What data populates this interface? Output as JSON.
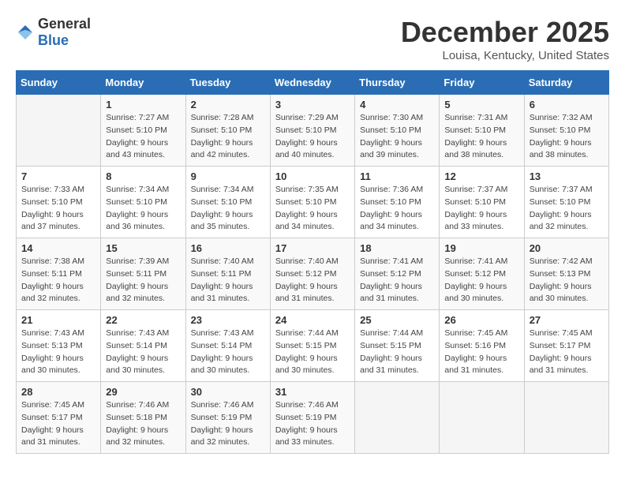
{
  "header": {
    "logo": {
      "general": "General",
      "blue": "Blue"
    },
    "title": "December 2025",
    "location": "Louisa, Kentucky, United States"
  },
  "days_of_week": [
    "Sunday",
    "Monday",
    "Tuesday",
    "Wednesday",
    "Thursday",
    "Friday",
    "Saturday"
  ],
  "weeks": [
    [
      {
        "day": "",
        "sunrise": "",
        "sunset": "",
        "daylight": ""
      },
      {
        "day": "1",
        "sunrise": "Sunrise: 7:27 AM",
        "sunset": "Sunset: 5:10 PM",
        "daylight": "Daylight: 9 hours and 43 minutes."
      },
      {
        "day": "2",
        "sunrise": "Sunrise: 7:28 AM",
        "sunset": "Sunset: 5:10 PM",
        "daylight": "Daylight: 9 hours and 42 minutes."
      },
      {
        "day": "3",
        "sunrise": "Sunrise: 7:29 AM",
        "sunset": "Sunset: 5:10 PM",
        "daylight": "Daylight: 9 hours and 40 minutes."
      },
      {
        "day": "4",
        "sunrise": "Sunrise: 7:30 AM",
        "sunset": "Sunset: 5:10 PM",
        "daylight": "Daylight: 9 hours and 39 minutes."
      },
      {
        "day": "5",
        "sunrise": "Sunrise: 7:31 AM",
        "sunset": "Sunset: 5:10 PM",
        "daylight": "Daylight: 9 hours and 38 minutes."
      },
      {
        "day": "6",
        "sunrise": "Sunrise: 7:32 AM",
        "sunset": "Sunset: 5:10 PM",
        "daylight": "Daylight: 9 hours and 38 minutes."
      }
    ],
    [
      {
        "day": "7",
        "sunrise": "Sunrise: 7:33 AM",
        "sunset": "Sunset: 5:10 PM",
        "daylight": "Daylight: 9 hours and 37 minutes."
      },
      {
        "day": "8",
        "sunrise": "Sunrise: 7:34 AM",
        "sunset": "Sunset: 5:10 PM",
        "daylight": "Daylight: 9 hours and 36 minutes."
      },
      {
        "day": "9",
        "sunrise": "Sunrise: 7:34 AM",
        "sunset": "Sunset: 5:10 PM",
        "daylight": "Daylight: 9 hours and 35 minutes."
      },
      {
        "day": "10",
        "sunrise": "Sunrise: 7:35 AM",
        "sunset": "Sunset: 5:10 PM",
        "daylight": "Daylight: 9 hours and 34 minutes."
      },
      {
        "day": "11",
        "sunrise": "Sunrise: 7:36 AM",
        "sunset": "Sunset: 5:10 PM",
        "daylight": "Daylight: 9 hours and 34 minutes."
      },
      {
        "day": "12",
        "sunrise": "Sunrise: 7:37 AM",
        "sunset": "Sunset: 5:10 PM",
        "daylight": "Daylight: 9 hours and 33 minutes."
      },
      {
        "day": "13",
        "sunrise": "Sunrise: 7:37 AM",
        "sunset": "Sunset: 5:10 PM",
        "daylight": "Daylight: 9 hours and 32 minutes."
      }
    ],
    [
      {
        "day": "14",
        "sunrise": "Sunrise: 7:38 AM",
        "sunset": "Sunset: 5:11 PM",
        "daylight": "Daylight: 9 hours and 32 minutes."
      },
      {
        "day": "15",
        "sunrise": "Sunrise: 7:39 AM",
        "sunset": "Sunset: 5:11 PM",
        "daylight": "Daylight: 9 hours and 32 minutes."
      },
      {
        "day": "16",
        "sunrise": "Sunrise: 7:40 AM",
        "sunset": "Sunset: 5:11 PM",
        "daylight": "Daylight: 9 hours and 31 minutes."
      },
      {
        "day": "17",
        "sunrise": "Sunrise: 7:40 AM",
        "sunset": "Sunset: 5:12 PM",
        "daylight": "Daylight: 9 hours and 31 minutes."
      },
      {
        "day": "18",
        "sunrise": "Sunrise: 7:41 AM",
        "sunset": "Sunset: 5:12 PM",
        "daylight": "Daylight: 9 hours and 31 minutes."
      },
      {
        "day": "19",
        "sunrise": "Sunrise: 7:41 AM",
        "sunset": "Sunset: 5:12 PM",
        "daylight": "Daylight: 9 hours and 30 minutes."
      },
      {
        "day": "20",
        "sunrise": "Sunrise: 7:42 AM",
        "sunset": "Sunset: 5:13 PM",
        "daylight": "Daylight: 9 hours and 30 minutes."
      }
    ],
    [
      {
        "day": "21",
        "sunrise": "Sunrise: 7:43 AM",
        "sunset": "Sunset: 5:13 PM",
        "daylight": "Daylight: 9 hours and 30 minutes."
      },
      {
        "day": "22",
        "sunrise": "Sunrise: 7:43 AM",
        "sunset": "Sunset: 5:14 PM",
        "daylight": "Daylight: 9 hours and 30 minutes."
      },
      {
        "day": "23",
        "sunrise": "Sunrise: 7:43 AM",
        "sunset": "Sunset: 5:14 PM",
        "daylight": "Daylight: 9 hours and 30 minutes."
      },
      {
        "day": "24",
        "sunrise": "Sunrise: 7:44 AM",
        "sunset": "Sunset: 5:15 PM",
        "daylight": "Daylight: 9 hours and 30 minutes."
      },
      {
        "day": "25",
        "sunrise": "Sunrise: 7:44 AM",
        "sunset": "Sunset: 5:15 PM",
        "daylight": "Daylight: 9 hours and 31 minutes."
      },
      {
        "day": "26",
        "sunrise": "Sunrise: 7:45 AM",
        "sunset": "Sunset: 5:16 PM",
        "daylight": "Daylight: 9 hours and 31 minutes."
      },
      {
        "day": "27",
        "sunrise": "Sunrise: 7:45 AM",
        "sunset": "Sunset: 5:17 PM",
        "daylight": "Daylight: 9 hours and 31 minutes."
      }
    ],
    [
      {
        "day": "28",
        "sunrise": "Sunrise: 7:45 AM",
        "sunset": "Sunset: 5:17 PM",
        "daylight": "Daylight: 9 hours and 31 minutes."
      },
      {
        "day": "29",
        "sunrise": "Sunrise: 7:46 AM",
        "sunset": "Sunset: 5:18 PM",
        "daylight": "Daylight: 9 hours and 32 minutes."
      },
      {
        "day": "30",
        "sunrise": "Sunrise: 7:46 AM",
        "sunset": "Sunset: 5:19 PM",
        "daylight": "Daylight: 9 hours and 32 minutes."
      },
      {
        "day": "31",
        "sunrise": "Sunrise: 7:46 AM",
        "sunset": "Sunset: 5:19 PM",
        "daylight": "Daylight: 9 hours and 33 minutes."
      },
      {
        "day": "",
        "sunrise": "",
        "sunset": "",
        "daylight": ""
      },
      {
        "day": "",
        "sunrise": "",
        "sunset": "",
        "daylight": ""
      },
      {
        "day": "",
        "sunrise": "",
        "sunset": "",
        "daylight": ""
      }
    ]
  ]
}
